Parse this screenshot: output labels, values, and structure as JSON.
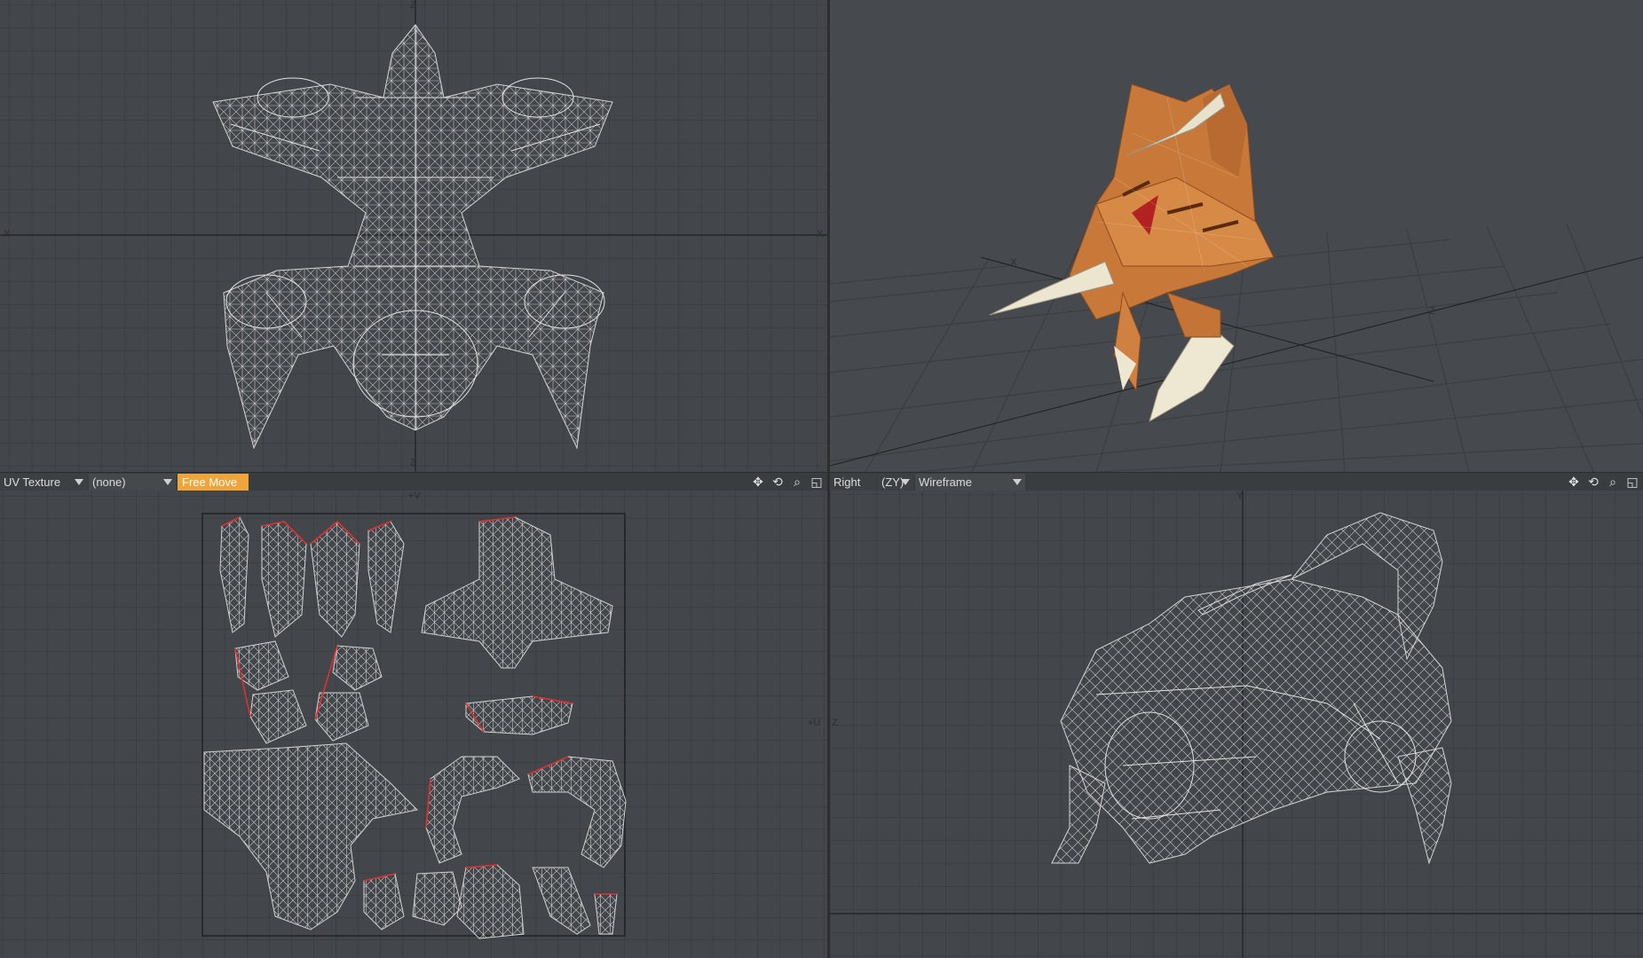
{
  "toolbar_left": {
    "projection": "UV Texture",
    "map": "(none)",
    "tool": "Free Move"
  },
  "toolbar_right": {
    "view": "Right",
    "axes": "(ZY)",
    "shading": "Wireframe"
  },
  "icons": {
    "move": "move-icon",
    "rotate": "rotate-icon",
    "zoom": "zoom-icon",
    "maximize": "maximize-icon"
  },
  "axis_labels": {
    "tl_top": "Z",
    "tl_left": "X",
    "tl_right": "X",
    "tl_bottom": "Z",
    "uv_top": "+V",
    "uv_left": "+U",
    "br_top": "Y",
    "br_left": "Z",
    "persp_x": "X",
    "persp_z": "Z"
  },
  "colors": {
    "viewport_bg": "#43464a",
    "grid": "#36383b",
    "wire": "#cfcfcf",
    "uv_seam": "#e03030",
    "accent": "#f0a53a",
    "model_skin": "#c87a3a"
  }
}
